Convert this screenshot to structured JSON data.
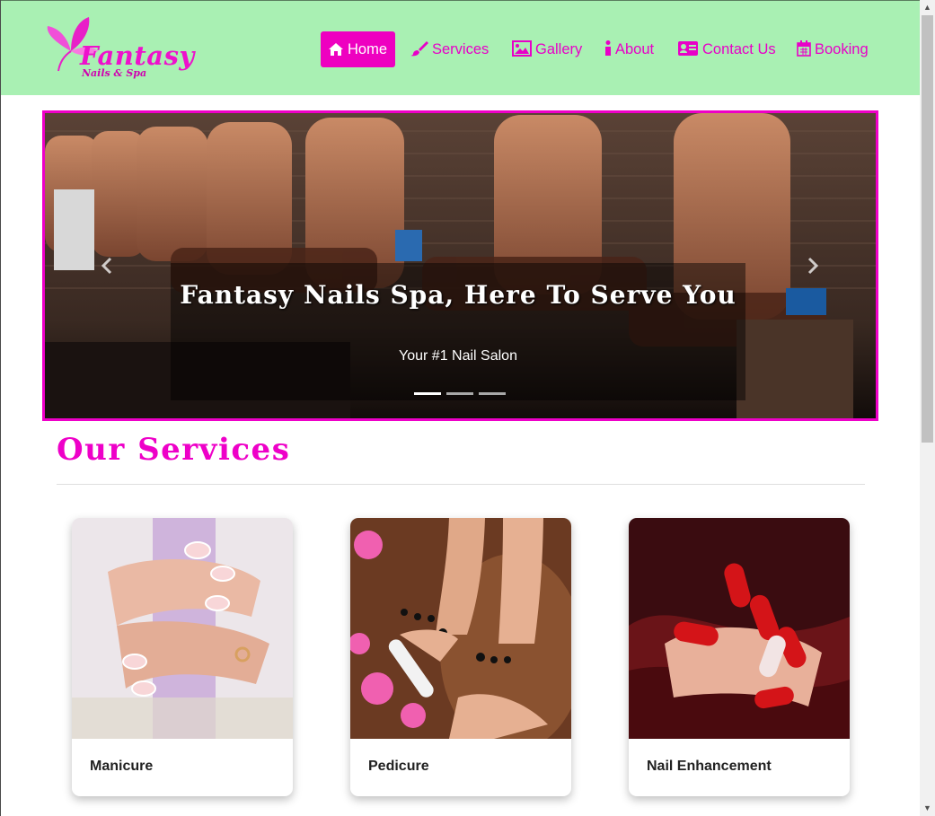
{
  "brand": {
    "name": "Fantasy",
    "tagline": "Nails & Spa"
  },
  "nav": {
    "items": [
      {
        "label": "Home",
        "icon": "home-icon",
        "active": true
      },
      {
        "label": "Services",
        "icon": "brush-icon",
        "active": false
      },
      {
        "label": "Gallery",
        "icon": "image-icon",
        "active": false
      },
      {
        "label": "About",
        "icon": "info-icon",
        "active": false
      },
      {
        "label": "Contact Us",
        "icon": "contact-card-icon",
        "active": false
      },
      {
        "label": "Booking",
        "icon": "calendar-icon",
        "active": false
      }
    ]
  },
  "carousel": {
    "title": "Fantasy Nails Spa, Here To Serve You",
    "subtitle": "Your #1 Nail Salon",
    "slide_count": 3,
    "active_slide": 1,
    "prev_icon": "chevron-left-icon",
    "next_icon": "chevron-right-icon"
  },
  "services": {
    "heading": "Our Services",
    "cards": [
      {
        "label": "Manicure"
      },
      {
        "label": "Pedicure"
      },
      {
        "label": "Nail Enhancement"
      }
    ]
  },
  "colors": {
    "accent": "#ee00c8",
    "nav_bg": "#a9f0b3"
  }
}
